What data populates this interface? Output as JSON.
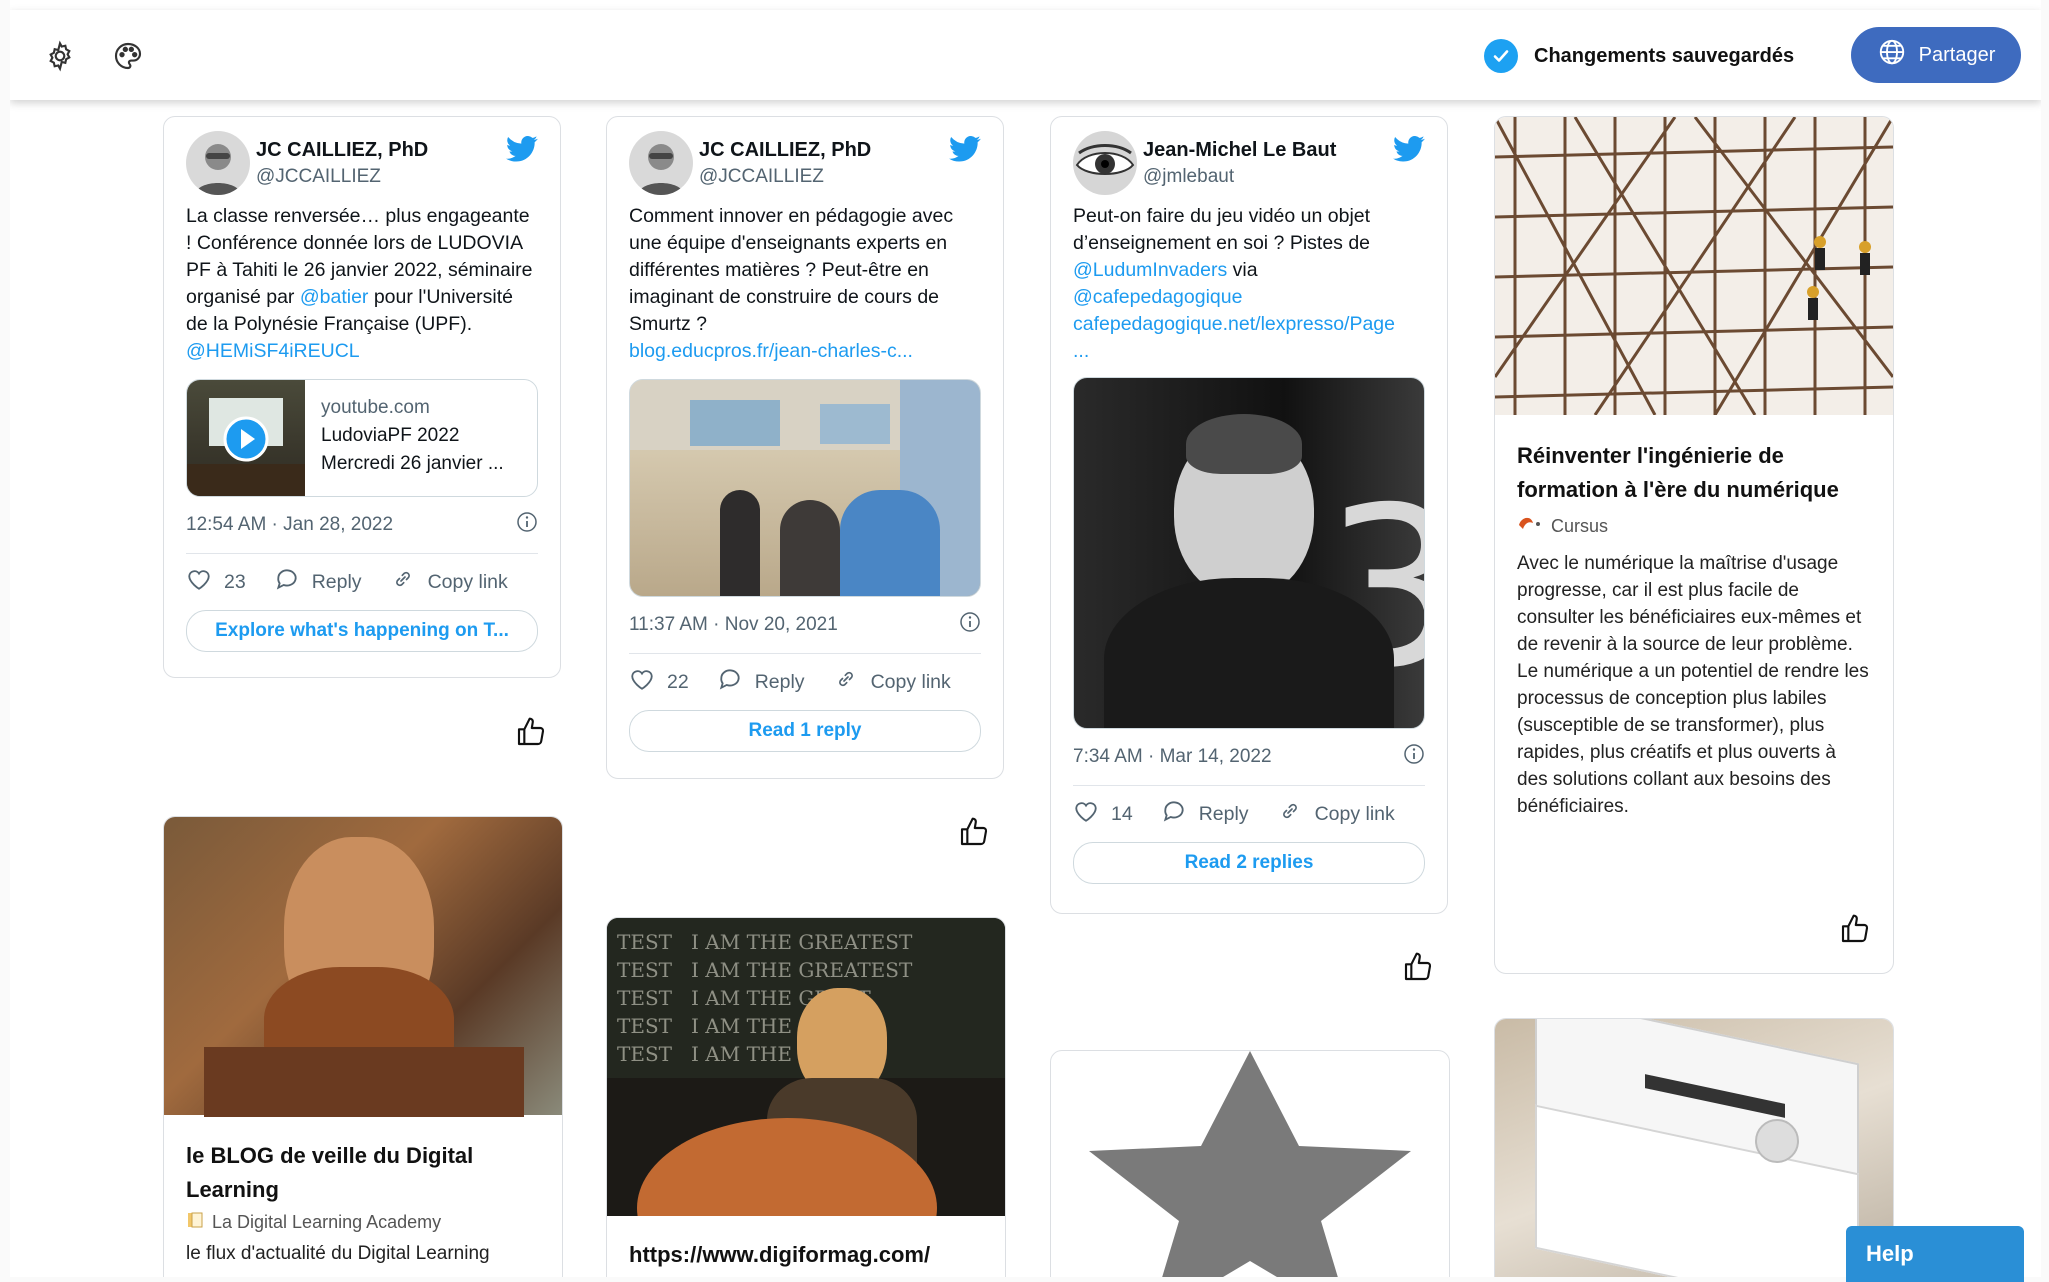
{
  "toolbar": {
    "icons": [
      "gear-icon",
      "palette-icon"
    ],
    "saved_status": "Changements sauvegardés",
    "share_label": "Partager"
  },
  "tweets": [
    {
      "name": "JC CAILLIEZ, PhD",
      "handle": "@JCCAILLIEZ",
      "text_before": "La classe renversée… plus engageante ! Conférence donnée lors de LUDOVIA PF à Tahiti le 26 janvier 2022, séminaire organisé par ",
      "link1": "@batier",
      "text_mid": " pour l'Université de la Polynésie Française (UPF). ",
      "link2": "@HEMiSF4iREUCL",
      "preview": {
        "domain": "youtube.com",
        "title": "LudoviaPF 2022",
        "subtitle": "Mercredi 26 janvier ..."
      },
      "timestamp": "12:54 AM · Jan 28, 2022",
      "likes": "23",
      "reply_label": "Reply",
      "copy_label": "Copy link",
      "button": "Explore what's happening on T..."
    },
    {
      "name": "JC CAILLIEZ, PhD",
      "handle": "@JCCAILLIEZ",
      "text": "Comment innover en pédagogie avec une équipe d'enseignants experts en différentes matières ? Peut-être en imaginant de construire de cours de Smurtz ?",
      "link": "blog.educpros.fr/jean-charles-c...",
      "timestamp": "11:37 AM · Nov 20, 2021",
      "likes": "22",
      "reply_label": "Reply",
      "copy_label": "Copy link",
      "button": "Read 1 reply"
    },
    {
      "name": "Jean-Michel Le Baut",
      "handle": "@jmlebaut",
      "text": "Peut-on faire du jeu vidéo un objet d’enseignement en soi ? Pistes de",
      "link1": "@LudumInvaders",
      "via": " via",
      "link2": "@cafepedagogique",
      "link3": "cafepedagogique.net/lexpresso/Page",
      "link4": "...",
      "timestamp": "7:34 AM · Mar 14, 2022",
      "likes": "14",
      "reply_label": "Reply",
      "copy_label": "Copy link",
      "button": "Read 2 replies"
    }
  ],
  "articles": [
    {
      "title": "Réinventer l'ingénierie de formation à l'ère du numérique",
      "source": "Cursus",
      "description": "Avec le numérique la maîtrise d'usage progresse, car il est plus facile de consulter les bénéficiaires eux-mêmes et de revenir à la source de leur problème. Le numérique a un potentiel de rendre les processus de conception plus labiles (susceptible de se transformer), plus rapides, plus créatifs et plus ouverts à des solutions collant aux besoins des bénéficiaires."
    },
    {
      "title": "le BLOG de veille du Digital Learning",
      "source": "La Digital Learning Academy",
      "description": "le flux d'actualité du Digital Learning"
    },
    {
      "title": "https://www.digiformag.com/"
    }
  ],
  "help_label": "Help",
  "colors": {
    "accent": "#3e6bbf",
    "twitter_blue": "#1d9bf0",
    "check": "#1da1f2"
  }
}
